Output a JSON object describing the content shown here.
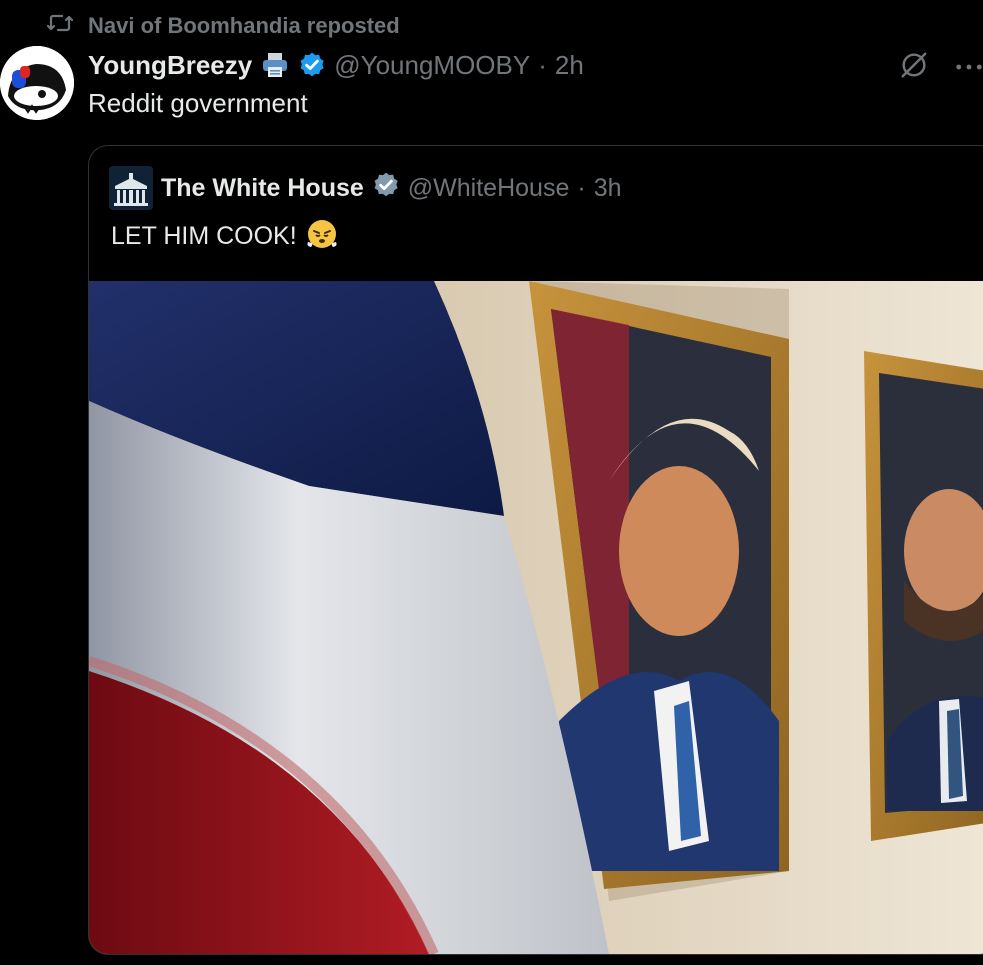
{
  "repost": {
    "label": "Navi of Boomhandia reposted",
    "icon": "repost-icon"
  },
  "tweet": {
    "display_name": "YoungBreezy",
    "name_emoji": "printer-icon",
    "handle": "@YoungMOOBY",
    "separator": "·",
    "time": "2h",
    "text": "Reddit government"
  },
  "quoted": {
    "display_name": "The White House",
    "handle": "@WhiteHouse",
    "separator": "·",
    "time": "3h",
    "text": "LET HIM COOK!",
    "emoji": "steam-face-emoji"
  },
  "icons": {
    "verified": "verified-badge-icon",
    "grok": "grok-icon",
    "more": "more-icon"
  },
  "colors": {
    "background": "#000000",
    "text": "#e7e9ea",
    "muted": "#71767b",
    "verified_blue": "#1d9bf0",
    "verified_gray": "#829aab"
  }
}
